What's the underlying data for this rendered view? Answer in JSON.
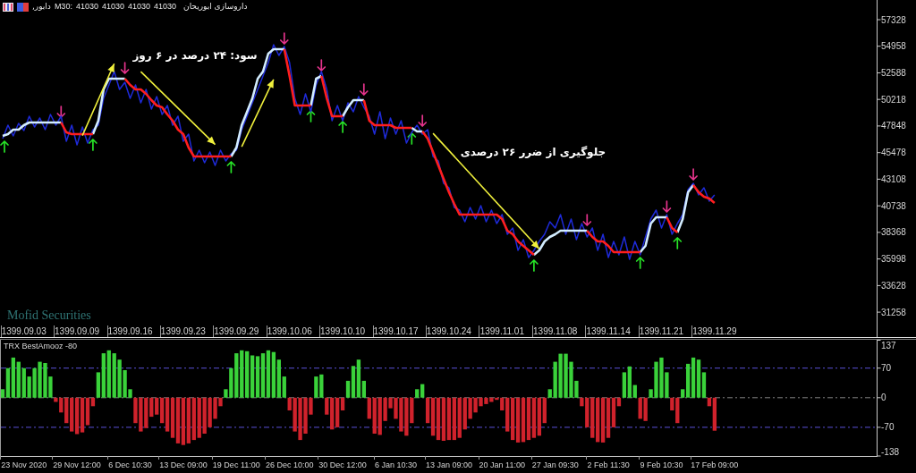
{
  "header": {
    "symbol": "دابور,",
    "timeframe": "M30:",
    "prices": [
      "41030",
      "41030",
      "41030",
      "41030"
    ],
    "description": "داروسازی ابوریحان"
  },
  "main_chart": {
    "broker_label": "Mofid Securities",
    "chart_data": {
      "type": "line",
      "ylim": [
        29114,
        59081
      ],
      "categories": [
        null,
        null,
        null,
        null,
        "1399.09.03",
        null,
        null,
        null,
        null,
        null,
        null,
        null,
        null,
        null,
        "1399.09.09",
        null,
        null,
        null,
        null,
        null,
        null,
        null,
        null,
        null,
        "1399.09.16",
        null,
        null,
        null,
        null,
        null,
        null,
        null,
        null,
        null,
        "1399.09.23",
        null,
        null,
        null,
        null,
        null,
        null,
        null,
        null,
        null,
        "1399.09.29",
        null,
        null,
        null,
        null,
        null,
        null,
        null,
        null,
        null,
        "1399.10.06",
        null,
        null,
        null,
        null,
        null,
        null,
        null,
        null,
        null,
        "1399.10.10",
        null,
        null,
        null,
        null,
        null,
        null,
        null,
        null,
        null,
        "1399.10.17",
        null,
        null,
        null,
        null,
        null,
        null,
        null,
        null,
        null,
        "1399.10.24",
        null,
        null,
        null,
        null,
        null,
        null,
        null,
        null,
        null,
        "1399.11.01",
        null,
        null,
        null,
        null,
        null,
        null,
        null,
        null,
        null,
        "1399.11.08",
        null,
        null,
        null,
        null,
        null,
        null,
        null,
        null,
        null,
        "1399.11.14",
        null,
        null,
        null,
        null,
        null,
        null,
        null,
        null,
        null,
        "1399.11.21",
        null,
        null,
        null,
        null,
        null,
        null,
        null,
        null,
        null,
        "1399.11.29",
        null,
        null,
        null,
        null,
        null,
        null,
        null,
        null,
        null,
        null,
        null,
        null,
        null,
        null,
        null,
        null,
        null,
        null,
        null,
        null,
        null,
        null,
        null,
        null,
        null,
        null,
        null,
        null,
        null,
        null
      ],
      "yticks": [
        57328,
        54958,
        52588,
        50218,
        47848,
        45478,
        43108,
        40738,
        38368,
        35998,
        33628,
        31258
      ],
      "series": [
        {
          "color": "#1e2ad8",
          "values": [
            46727,
            47923,
            46967,
            48082,
            47445,
            48720,
            47764,
            48560,
            47524,
            48879,
            47923,
            48720,
            46488,
            47923,
            46170,
            47764,
            46329,
            47524,
            47923,
            50314,
            51509,
            52705,
            51111,
            51749,
            50314,
            51509,
            49915,
            51111,
            49358,
            50473,
            48879,
            49676,
            47923,
            48720,
            46488,
            47126,
            44735,
            45691,
            44576,
            45532,
            44336,
            45691,
            44735,
            45373,
            45691,
            47524,
            48720,
            49915,
            51111,
            52306,
            53502,
            55096,
            54140,
            54937,
            53502,
            50314,
            48879,
            50712,
            49118,
            51509,
            52705,
            51111,
            48321,
            49676,
            48321,
            49915,
            49118,
            50473,
            49517,
            48720,
            47126,
            49118,
            46727,
            48560,
            47126,
            48321,
            46329,
            47285,
            47923,
            47126,
            47524,
            45133,
            44735,
            42742,
            42344,
            40591,
            40352,
            39316,
            40591,
            39555,
            40750,
            39316,
            40352,
            39156,
            39953,
            38200,
            38758,
            36765,
            37721,
            36127,
            36765,
            37562,
            38200,
            39316,
            38758,
            39953,
            38200,
            39555,
            37721,
            39156,
            37961,
            38758,
            36765,
            38200,
            36127,
            37562,
            36366,
            37961,
            35968,
            37562,
            36366,
            37961,
            39555,
            40352,
            38758,
            39953,
            38200,
            39156,
            39953,
            42185,
            42742,
            41706,
            42344,
            41149,
            41706,
            null,
            null,
            null,
            null,
            null,
            null,
            null,
            null,
            null,
            null,
            null,
            null,
            null,
            null,
            null,
            null,
            null,
            null,
            null,
            null,
            null,
            null,
            null,
            null,
            null,
            null,
            null,
            null,
            null,
            null
          ]
        },
        {
          "color": "#d2ecff",
          "values": [
            46967,
            47126,
            47524,
            47524,
            47923,
            48162,
            48162,
            48162,
            48162,
            48162,
            48162,
            48162,
            null,
            null,
            null,
            null,
            null,
            47126,
            48321,
            51111,
            52067,
            52067,
            52067,
            52067,
            null,
            null,
            null,
            null,
            null,
            null,
            null,
            null,
            null,
            null,
            null,
            null,
            null,
            null,
            null,
            null,
            null,
            null,
            null,
            45133,
            45930,
            47923,
            49118,
            50314,
            52067,
            52705,
            54299,
            54697,
            54697,
            54697,
            null,
            null,
            null,
            null,
            49676,
            52067,
            52306,
            null,
            null,
            null,
            48720,
            49517,
            50155,
            50155,
            50155,
            null,
            null,
            null,
            null,
            null,
            null,
            null,
            null,
            47684,
            47365,
            47365,
            null,
            null,
            null,
            null,
            null,
            null,
            null,
            null,
            null,
            null,
            null,
            null,
            null,
            null,
            null,
            null,
            null,
            null,
            null,
            null,
            36366,
            36765,
            37562,
            37961,
            38200,
            38518,
            38518,
            38518,
            38518,
            38518,
            38518,
            null,
            null,
            null,
            null,
            null,
            null,
            null,
            null,
            null,
            36606,
            37163,
            39156,
            39714,
            39714,
            39714,
            null,
            38359,
            39555,
            41946,
            42583,
            null,
            null,
            null,
            null,
            null,
            null,
            null,
            null,
            null,
            null,
            null,
            null,
            null,
            null,
            null,
            null,
            null,
            null,
            null,
            null,
            null,
            null,
            null,
            null,
            null,
            null,
            null,
            null,
            null,
            null,
            null,
            null,
            null,
            null
          ]
        },
        {
          "color": "#ff1e1e",
          "values": [
            null,
            null,
            null,
            null,
            null,
            null,
            null,
            null,
            null,
            null,
            null,
            48162,
            47285,
            47126,
            47126,
            47126,
            47126,
            47126,
            null,
            null,
            null,
            null,
            null,
            52067,
            51509,
            51111,
            51111,
            50712,
            50155,
            49676,
            49517,
            48879,
            48321,
            47524,
            47126,
            45930,
            45133,
            45133,
            45133,
            45133,
            45133,
            45133,
            45133,
            45133,
            null,
            null,
            null,
            null,
            null,
            null,
            null,
            null,
            null,
            54697,
            52306,
            49676,
            49676,
            49676,
            49676,
            null,
            52306,
            50314,
            48720,
            48720,
            48720,
            null,
            null,
            null,
            50155,
            48321,
            47923,
            47923,
            47923,
            47923,
            47684,
            47684,
            47684,
            47684,
            null,
            47365,
            46727,
            45532,
            44336,
            43141,
            41946,
            40909,
            39953,
            39953,
            39953,
            39953,
            39953,
            39953,
            39953,
            39953,
            39555,
            38518,
            38200,
            37562,
            37163,
            36765,
            36366,
            null,
            null,
            null,
            null,
            null,
            null,
            null,
            null,
            null,
            38518,
            37961,
            37562,
            37562,
            37163,
            36606,
            36606,
            36606,
            36606,
            36606,
            36606,
            null,
            null,
            null,
            null,
            39714,
            38758,
            38359,
            null,
            null,
            42583,
            41946,
            41547,
            41388,
            40989,
            null,
            null,
            null,
            null,
            null,
            null,
            null,
            null,
            null,
            null,
            null,
            null,
            null,
            null,
            null,
            null,
            null,
            null,
            null,
            null,
            null,
            null,
            null,
            null,
            null,
            null,
            null,
            null,
            null,
            null
          ]
        },
        {
          "color": "#f0f03c",
          "values": [
            null,
            null,
            null,
            null,
            null,
            null,
            null,
            null,
            null,
            null,
            null,
            null,
            null,
            null,
            null,
            47000,
            48067,
            49133,
            50200,
            51267,
            52333,
            53400,
            null,
            null,
            null,
            null,
            52700,
            52236,
            51771,
            51307,
            50843,
            50379,
            49914,
            49450,
            48986,
            48521,
            48057,
            47593,
            47129,
            46664,
            46200,
            null,
            null,
            null,
            null,
            46000,
            47000,
            48000,
            49000,
            50000,
            51000,
            52000,
            null,
            null,
            null,
            null,
            null,
            null,
            null,
            null,
            null,
            null,
            null,
            null,
            null,
            null,
            null,
            null,
            null,
            null,
            null,
            null,
            null,
            null,
            null,
            null,
            null,
            null,
            null,
            null,
            null,
            47200,
            46685,
            46170,
            45655,
            45140,
            44625,
            44110,
            43595,
            43080,
            42565,
            42050,
            41535,
            41020,
            40505,
            39990,
            39475,
            38960,
            38445,
            37930,
            37415,
            36900,
            null,
            null,
            null,
            null,
            null,
            null,
            null,
            null,
            null,
            null,
            null,
            null,
            null,
            null,
            null,
            null,
            null,
            null,
            null,
            null,
            null,
            null,
            null,
            null,
            null,
            null,
            null,
            null,
            null,
            null,
            null,
            null,
            null,
            null,
            null,
            null,
            null,
            null,
            null,
            null,
            null,
            null,
            null,
            null,
            null,
            null,
            null,
            null,
            null,
            null,
            null,
            null,
            null,
            null,
            null,
            null,
            null,
            null,
            null,
            null,
            null,
            null,
            null
          ]
        }
      ],
      "annotations": [
        "سود: ۲۴ درصد در ۶ روز",
        "جلوگیری از ضرر ۲۶ درصدی"
      ]
    }
  },
  "indicator": {
    "chart_data": {
      "type": "bar",
      "title": "TRX BestAmooz -80",
      "ylim": [
        -138,
        137
      ],
      "stacked": true,
      "categories": [
        null,
        null,
        null,
        null,
        "23 Nov 2020",
        null,
        null,
        null,
        null,
        null,
        null,
        null,
        null,
        null,
        "29 Nov 12:00",
        null,
        null,
        null,
        null,
        null,
        null,
        null,
        null,
        null,
        "6 Dec 10:30",
        null,
        null,
        null,
        null,
        null,
        null,
        null,
        null,
        null,
        "13 Dec 09:00",
        null,
        null,
        null,
        null,
        null,
        null,
        null,
        null,
        null,
        "19 Dec 11:00",
        null,
        null,
        null,
        null,
        null,
        null,
        null,
        null,
        null,
        "26 Dec 10:00",
        null,
        null,
        null,
        null,
        null,
        null,
        null,
        null,
        null,
        "30 Dec 12:00",
        null,
        null,
        null,
        null,
        null,
        null,
        null,
        null,
        null,
        "6 Jan 10:30",
        null,
        null,
        null,
        null,
        null,
        null,
        null,
        null,
        null,
        "13 Jan 09:00",
        null,
        null,
        null,
        null,
        null,
        null,
        null,
        null,
        null,
        "20 Jan 11:00",
        null,
        null,
        null,
        null,
        null,
        null,
        null,
        null,
        null,
        "27 Jan 09:30",
        null,
        null,
        null,
        null,
        null,
        null,
        null,
        null,
        null,
        "2 Feb 11:30",
        null,
        null,
        null,
        null,
        null,
        null,
        null,
        null,
        null,
        "9 Feb 10:30",
        null,
        null,
        null,
        null,
        null,
        null,
        null,
        null,
        null,
        "17 Feb 09:00",
        null,
        null,
        null,
        null,
        null,
        null,
        null,
        null,
        null,
        null,
        null,
        null,
        null,
        null,
        null,
        null,
        null,
        null,
        null,
        null,
        null,
        null,
        null,
        null,
        null,
        null,
        null,
        null,
        null,
        null
      ],
      "yticks": [
        137,
        70,
        0,
        -70,
        -138
      ],
      "series": [
        {
          "color": "#3ad23a",
          "values": [
            20,
            70,
            95,
            85,
            70,
            50,
            70,
            85,
            82,
            50,
            null,
            null,
            null,
            null,
            null,
            null,
            null,
            null,
            60,
            105,
            112,
            105,
            90,
            65,
            20,
            null,
            null,
            null,
            null,
            null,
            null,
            null,
            null,
            null,
            null,
            null,
            null,
            null,
            null,
            null,
            null,
            null,
            20,
            70,
            105,
            112,
            110,
            100,
            98,
            105,
            112,
            108,
            90,
            50,
            null,
            null,
            null,
            null,
            null,
            50,
            55,
            null,
            null,
            null,
            null,
            40,
            75,
            90,
            40,
            null,
            null,
            null,
            null,
            null,
            null,
            null,
            null,
            null,
            20,
            32,
            null,
            null,
            null,
            null,
            null,
            null,
            null,
            null,
            null,
            null,
            null,
            null,
            null,
            null,
            null,
            null,
            null,
            null,
            null,
            null,
            null,
            null,
            null,
            20,
            85,
            104,
            104,
            85,
            40,
            null,
            null,
            null,
            null,
            null,
            null,
            null,
            null,
            60,
            74,
            30,
            null,
            null,
            20,
            85,
            95,
            60,
            null,
            null,
            20,
            80,
            95,
            90,
            60,
            null,
            null,
            null,
            null,
            null,
            null,
            null,
            null,
            null,
            null,
            null,
            null,
            null,
            null,
            null,
            null,
            null,
            null,
            null,
            null,
            null,
            null,
            null,
            null,
            null,
            null,
            null,
            null,
            null,
            null,
            null,
            null
          ]
        },
        {
          "color": "#d0222c",
          "values": [
            null,
            null,
            null,
            null,
            null,
            null,
            null,
            null,
            null,
            null,
            -10,
            -35,
            -60,
            -80,
            -86,
            -82,
            -65,
            -20,
            null,
            null,
            null,
            null,
            null,
            null,
            null,
            -60,
            -80,
            -72,
            -45,
            -40,
            -60,
            -80,
            -95,
            -108,
            -112,
            -108,
            -100,
            -95,
            -85,
            -70,
            -50,
            -20,
            null,
            null,
            null,
            null,
            null,
            null,
            null,
            null,
            null,
            null,
            null,
            null,
            -30,
            -80,
            -100,
            -85,
            -40,
            null,
            null,
            -40,
            -75,
            -70,
            -30,
            null,
            null,
            null,
            null,
            -50,
            -85,
            -88,
            -55,
            -25,
            -50,
            -80,
            -90,
            -60,
            null,
            null,
            -60,
            -90,
            -100,
            -102,
            -100,
            -100,
            -95,
            -75,
            -50,
            -35,
            -20,
            -15,
            -10,
            -5,
            -30,
            -80,
            -100,
            -106,
            -105,
            -100,
            -95,
            -90,
            -60,
            null,
            null,
            null,
            null,
            null,
            null,
            -20,
            -70,
            -95,
            -105,
            -106,
            -95,
            -70,
            -20,
            null,
            null,
            null,
            -50,
            -55,
            null,
            null,
            null,
            null,
            -30,
            -60,
            null,
            null,
            null,
            null,
            null,
            -20,
            -78,
            null,
            null,
            null,
            null,
            null,
            null,
            null,
            null,
            null,
            null,
            null,
            null,
            null,
            null,
            null,
            null,
            null,
            null,
            null,
            null,
            null,
            null,
            null,
            null,
            null,
            null,
            null,
            null,
            null,
            null
          ]
        }
      ],
      "ref_lines": [
        {
          "axis": "y",
          "value": 70
        },
        {
          "axis": "y",
          "value": 0
        },
        {
          "axis": "y",
          "value": -70
        }
      ]
    }
  }
}
